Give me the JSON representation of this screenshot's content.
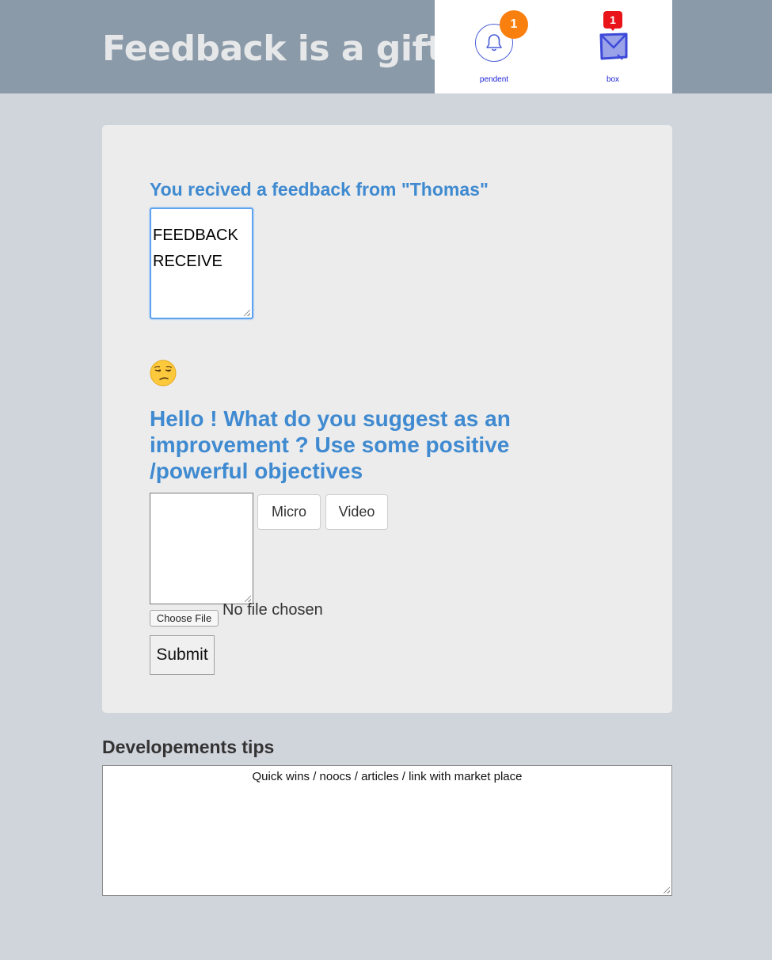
{
  "header": {
    "title": "Feedback is a gift ..!",
    "notifications": [
      {
        "icon": "bell-icon",
        "badge": "1",
        "label": "pendent",
        "badge_color": "#f97f0f"
      },
      {
        "icon": "mail-icon",
        "badge": "1",
        "label": "box",
        "badge_color": "#e8141a"
      }
    ]
  },
  "received": {
    "heading": "You recived a feedback from \"Thomas\"",
    "lines": [
      "FEEDBACK",
      "RECEIVE"
    ]
  },
  "mood": {
    "icon": "unamused-face-emoji"
  },
  "suggestion": {
    "heading": "Hello ! What do you suggest as an improvement ? Use some positive /powerful objectives",
    "micro_label": "Micro",
    "video_label": "Video",
    "choose_file_label": "Choose File",
    "file_status": "No file chosen",
    "submit_label": "Submit"
  },
  "tips": {
    "heading": "Developements tips",
    "content": "Quick wins / noocs / articles / link with market place"
  },
  "colors": {
    "header_bg": "#8b9aa8",
    "page_bg": "#d0d4db",
    "card_bg": "#ececec",
    "heading_blue": "#3f8ad0",
    "notif_blue": "#4c5ed6"
  }
}
